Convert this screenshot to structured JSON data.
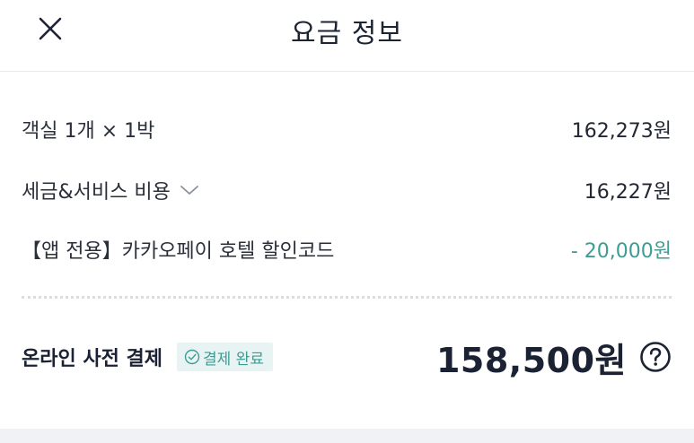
{
  "header": {
    "title": "요금 정보",
    "close_icon": "close-icon"
  },
  "rows": [
    {
      "label": "객실 1개 × 1박",
      "value": "162,273원"
    },
    {
      "label": "세금&서비스 비용",
      "value": "16,227원",
      "icon": "chevron-down-icon"
    },
    {
      "label": "【앱 전용】카카오페이 호텔 할인코드",
      "value": "- 20,000원",
      "value_color": "#3f9c93"
    }
  ],
  "total": {
    "label": "온라인 사전 결제",
    "badge": "결제 완료",
    "badge_icon": "check-circle-icon",
    "amount": "158,500원",
    "help_icon": "question-circle-icon"
  },
  "colors": {
    "accent": "#3f9c93",
    "badge_bg": "#e8f4f4",
    "text": "#1b2233"
  }
}
